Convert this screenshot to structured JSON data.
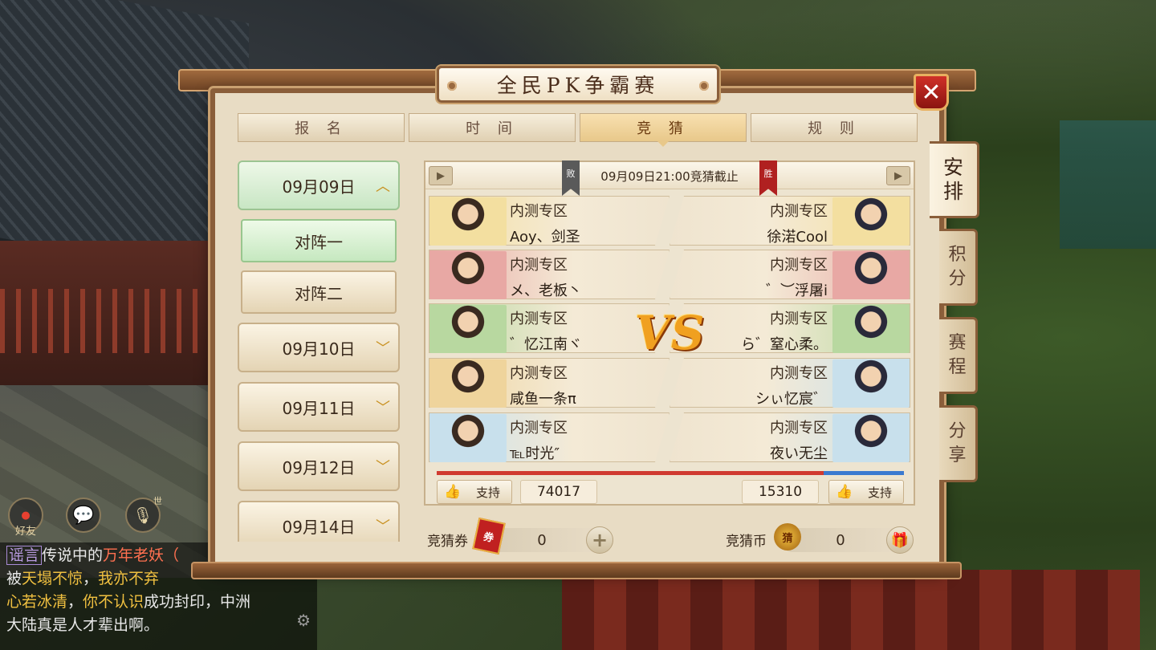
{
  "title": "全民PK争霸赛",
  "tabs": [
    {
      "label": "报 名",
      "active": false
    },
    {
      "label": "时 间",
      "active": false
    },
    {
      "label": "竞 猜",
      "active": true
    },
    {
      "label": "规 则",
      "active": false
    }
  ],
  "side_tabs": [
    {
      "label": "安\n排",
      "active": true
    },
    {
      "label": "积\n分",
      "active": false
    },
    {
      "label": "赛\n程",
      "active": false
    },
    {
      "label": "分\n享",
      "active": false
    }
  ],
  "dates": [
    {
      "label": "09月09日",
      "expanded": true
    },
    {
      "label": "09月10日",
      "expanded": false
    },
    {
      "label": "09月11日",
      "expanded": false
    },
    {
      "label": "09月12日",
      "expanded": false
    },
    {
      "label": "09月14日",
      "expanded": false
    }
  ],
  "matches": [
    {
      "label": "对阵一",
      "active": true
    },
    {
      "label": "对阵二",
      "active": false
    }
  ],
  "header": {
    "deadline": "09月09日21:00竞猜截止",
    "left_badge": "败",
    "right_badge": "胜",
    "left_badge_color": "#5a5a5a",
    "right_badge_color": "#b02020"
  },
  "vs_text": "VS",
  "left_players": [
    {
      "zone": "内测专区",
      "name": "Aoy、剑圣",
      "bg": "#f3dfa0"
    },
    {
      "zone": "内测专区",
      "name": "メ、老板丶",
      "bg": "#e8a8a4"
    },
    {
      "zone": "内测专区",
      "name": "゛忆江南ヾ",
      "bg": "#b8d8a0"
    },
    {
      "zone": "内测专区",
      "name": "咸鱼一条π",
      "bg": "#efd49c"
    },
    {
      "zone": "内测专区",
      "name": "℡时光″",
      "bg": "#c8e0ec"
    }
  ],
  "right_players": [
    {
      "zone": "内测专区",
      "name": "徐渃Cool",
      "bg": "#f3dfa0"
    },
    {
      "zone": "内测专区",
      "name": "゛︶浮屠i",
      "bg": "#e8a8a4"
    },
    {
      "zone": "内测专区",
      "name": "ら゛窒心柔。",
      "bg": "#b8d8a0"
    },
    {
      "zone": "内测专区",
      "name": "シぃ忆宸゛",
      "bg": "#c8e0ec"
    },
    {
      "zone": "内测专区",
      "name": "夜い无尘",
      "bg": "#c8e0ec"
    }
  ],
  "support_label": "支持",
  "left_votes": "74017",
  "right_votes": "15310",
  "left_share": 0.8286,
  "bottom": {
    "ticket_label": "竞猜券",
    "ticket_value": "0",
    "ticket_icon": "券",
    "coin_label": "竞猜币",
    "coin_value": "0",
    "coin_icon": "猜"
  },
  "chat_icons": {
    "friend": "好友",
    "voice_badge": "世"
  },
  "chat": {
    "tag": "谣言",
    "text1": "传说中的",
    "text2": "万年老妖",
    "text3": "（",
    "line2a": "被",
    "line2b": "天塌不惊",
    "line2c": "，",
    "line2d": "我亦不弃",
    "line3a": "心若冰清",
    "line3b": "，",
    "line3c": "你不认识",
    "line3d": "成功封印，中洲",
    "line4": "大陆真是人才辈出啊。"
  },
  "colors": {
    "panel_bg": "#e8dcc4",
    "frame": "#8a5e3a",
    "bar_left": "#d03a30",
    "bar_right": "#3a7ad0"
  }
}
